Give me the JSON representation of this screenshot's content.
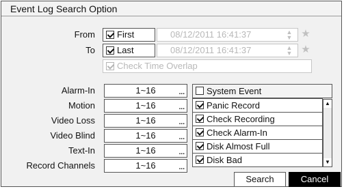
{
  "dialog": {
    "title": "Event Log Search Option"
  },
  "from": {
    "label": "From",
    "checkbox_label": "First",
    "checked": true,
    "datetime": "08/12/2011  16:41:37"
  },
  "to": {
    "label": "To",
    "checkbox_label": "Last",
    "checked": true,
    "datetime": "08/12/2011  16:41:37"
  },
  "overlap": {
    "label": "Check Time Overlap",
    "checked": true
  },
  "filters": [
    {
      "label": "Alarm-In",
      "value": "1~16"
    },
    {
      "label": "Motion",
      "value": "1~16"
    },
    {
      "label": "Video Loss",
      "value": "1~16"
    },
    {
      "label": "Video Blind",
      "value": "1~16"
    },
    {
      "label": "Text-In",
      "value": "1~16"
    },
    {
      "label": "Record Channels",
      "value": "1~16"
    }
  ],
  "events": {
    "header": {
      "label": "System Event",
      "checked": false
    },
    "items": [
      {
        "label": "Panic Record",
        "checked": true
      },
      {
        "label": "Check Recording",
        "checked": true
      },
      {
        "label": "Check Alarm-In",
        "checked": true
      },
      {
        "label": "Disk Almost Full",
        "checked": true
      },
      {
        "label": "Disk Bad",
        "checked": true
      }
    ]
  },
  "buttons": {
    "search": "Search",
    "cancel": "Cancel"
  },
  "icons": {
    "ellipsis": "...",
    "spinner": "spinner-icon",
    "star": "star-icon",
    "scroll_up": "chevron-up-icon",
    "scroll_down": "chevron-down-icon"
  }
}
